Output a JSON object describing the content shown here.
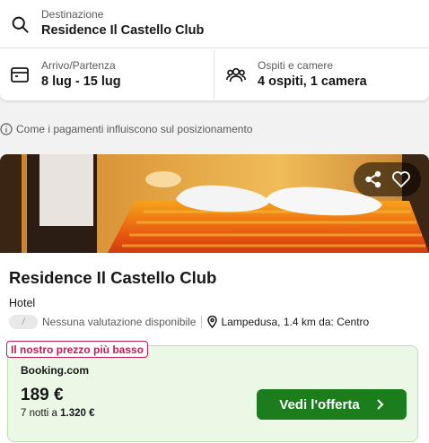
{
  "search": {
    "destination_label": "Destinazione",
    "destination_value": "Residence Il Castello Club",
    "dates_label": "Arrivo/Partenza",
    "dates_value": "8 lug - 15 lug",
    "guests_label": "Ospiti e camere",
    "guests_value": "4 ospiti, 1 camera"
  },
  "info_text": "Come i pagamenti influiscono sul posizionamento",
  "hotel": {
    "name": "Residence Il Castello Club",
    "type": "Hotel",
    "rating_pill": "/",
    "rating_text": "Nessuna valutazione disponibile",
    "location": "Lampedusa, 1.4 km da: Centro"
  },
  "deal": {
    "tag": "Il nostro prezzo più basso",
    "provider": "Booking.com",
    "price": "189 €",
    "nights_text": "7 notti a",
    "total_price": "1.320 €",
    "cta_label": "Vedi l'offerta"
  },
  "colors": {
    "accent_green": "#1c7d1c",
    "deal_bg": "#ebf8e6",
    "tag_red": "#c21c55"
  },
  "icons": [
    "search-icon",
    "calendar-icon",
    "guests-icon",
    "info-icon",
    "share-icon",
    "heart-icon",
    "location-pin-icon",
    "chevron-right-icon"
  ]
}
